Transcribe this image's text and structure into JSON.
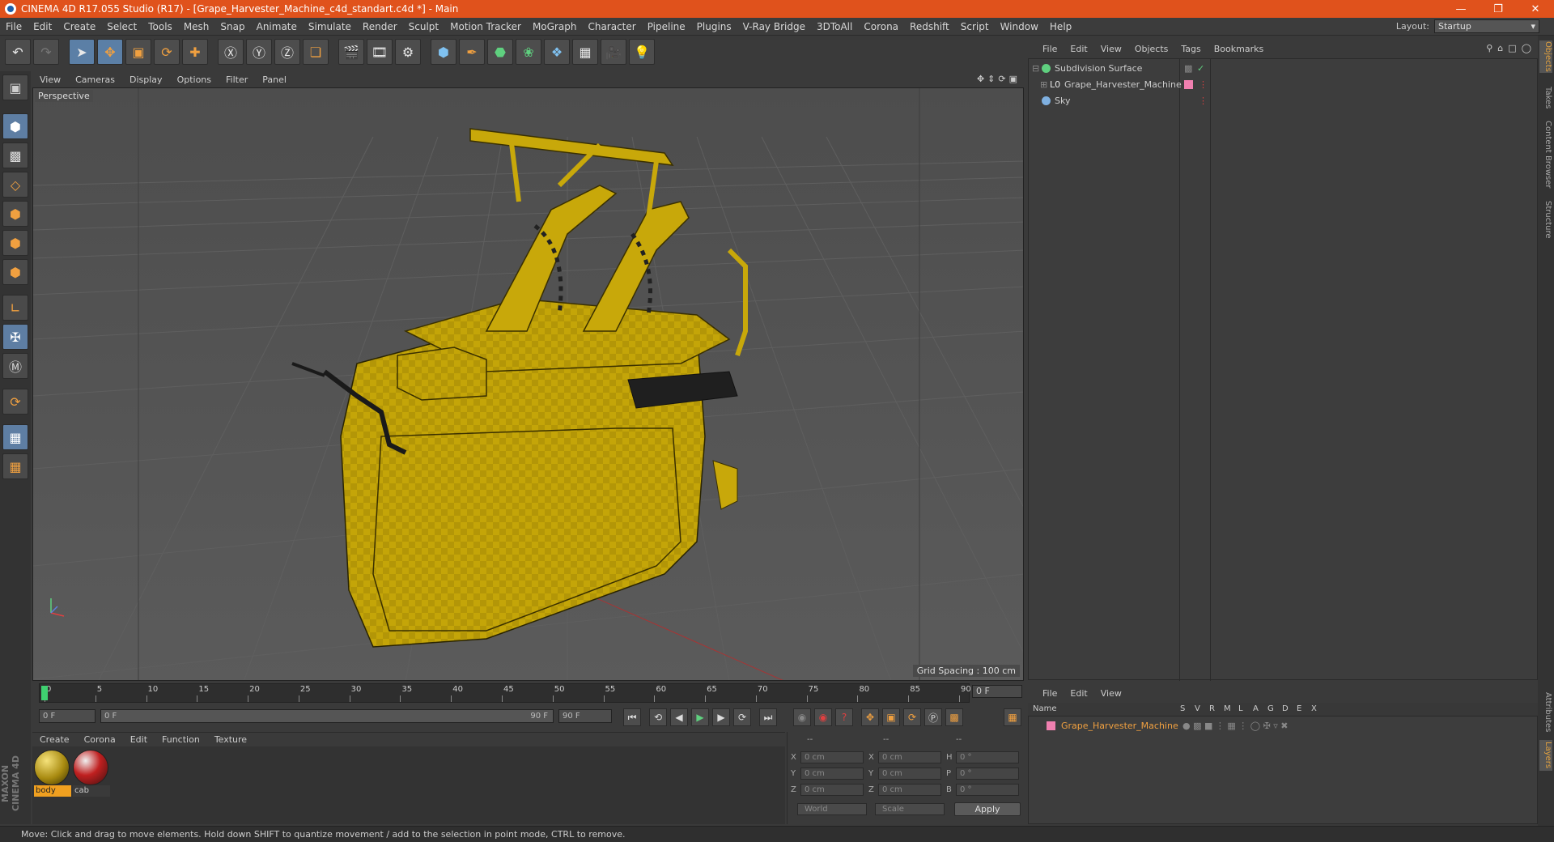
{
  "window": {
    "title": "CINEMA 4D R17.055 Studio (R17) - [Grape_Harvester_Machine_c4d_standart.c4d *] - Main"
  },
  "menubar": {
    "items": [
      "File",
      "Edit",
      "Create",
      "Select",
      "Tools",
      "Mesh",
      "Snap",
      "Animate",
      "Simulate",
      "Render",
      "Sculpt",
      "Motion Tracker",
      "MoGraph",
      "Character",
      "Pipeline",
      "Plugins",
      "V-Ray Bridge",
      "3DToAll",
      "Corona",
      "Redshift",
      "Script",
      "Window",
      "Help"
    ],
    "layout_label": "Layout:",
    "layout_value": "Startup"
  },
  "viewport": {
    "menu": [
      "View",
      "Cameras",
      "Display",
      "Options",
      "Filter",
      "Panel"
    ],
    "label": "Perspective",
    "grid_spacing": "Grid Spacing : 100 cm"
  },
  "timeline": {
    "ticks": [
      "0",
      "5",
      "10",
      "15",
      "20",
      "25",
      "30",
      "35",
      "40",
      "45",
      "50",
      "55",
      "60",
      "65",
      "70",
      "75",
      "80",
      "85",
      "90"
    ],
    "current_frame": "0 F",
    "start_field": "0 F",
    "range_start": "0 F",
    "range_end": "90 F",
    "end_field": "90 F"
  },
  "material_manager": {
    "menu": [
      "Create",
      "Corona",
      "Edit",
      "Function",
      "Texture"
    ],
    "materials": [
      {
        "name": "body"
      },
      {
        "name": "cab"
      }
    ]
  },
  "coord_manager": {
    "headers": [
      "--",
      "--",
      "--"
    ],
    "rows": [
      {
        "axis": "X",
        "pos": "0 cm",
        "axis2": "X",
        "size": "0 cm",
        "rot_axis": "H",
        "rot": "0 °"
      },
      {
        "axis": "Y",
        "pos": "0 cm",
        "axis2": "Y",
        "size": "0 cm",
        "rot_axis": "P",
        "rot": "0 °"
      },
      {
        "axis": "Z",
        "pos": "0 cm",
        "axis2": "Z",
        "size": "0 cm",
        "rot_axis": "B",
        "rot": "0 °"
      }
    ],
    "mode1": "World",
    "mode2": "Scale",
    "apply": "Apply"
  },
  "object_manager": {
    "menu": [
      "File",
      "Edit",
      "View",
      "Objects",
      "Tags",
      "Bookmarks"
    ],
    "objects": [
      {
        "name": "Subdivision Surface",
        "color": "#5fd07f"
      },
      {
        "name": "Grape_Harvester_Machine",
        "color": "#e8e8e8"
      },
      {
        "name": "Sky",
        "color": "#7fb0e0"
      }
    ]
  },
  "layer_manager": {
    "menu": [
      "File",
      "Edit",
      "View"
    ],
    "columns": [
      "Name",
      "S",
      "V",
      "R",
      "M",
      "L",
      "A",
      "G",
      "D",
      "E",
      "X"
    ],
    "layers": [
      {
        "name": "Grape_Harvester_Machine",
        "color": "#f080b0"
      }
    ]
  },
  "side_tabs": [
    "Objects",
    "Takes",
    "Content Browser",
    "Structure"
  ],
  "side_tabs_lower": [
    "Attributes",
    "Layers"
  ],
  "status": "Move: Click and drag to move elements. Hold down SHIFT to quantize movement / add to the selection in point mode, CTRL to remove.",
  "brand": "MAXON CINEMA 4D",
  "colors": {
    "title_bar": "#e0521c",
    "model_yellow": "#c8a80a",
    "selection": "#5b7fa6"
  }
}
